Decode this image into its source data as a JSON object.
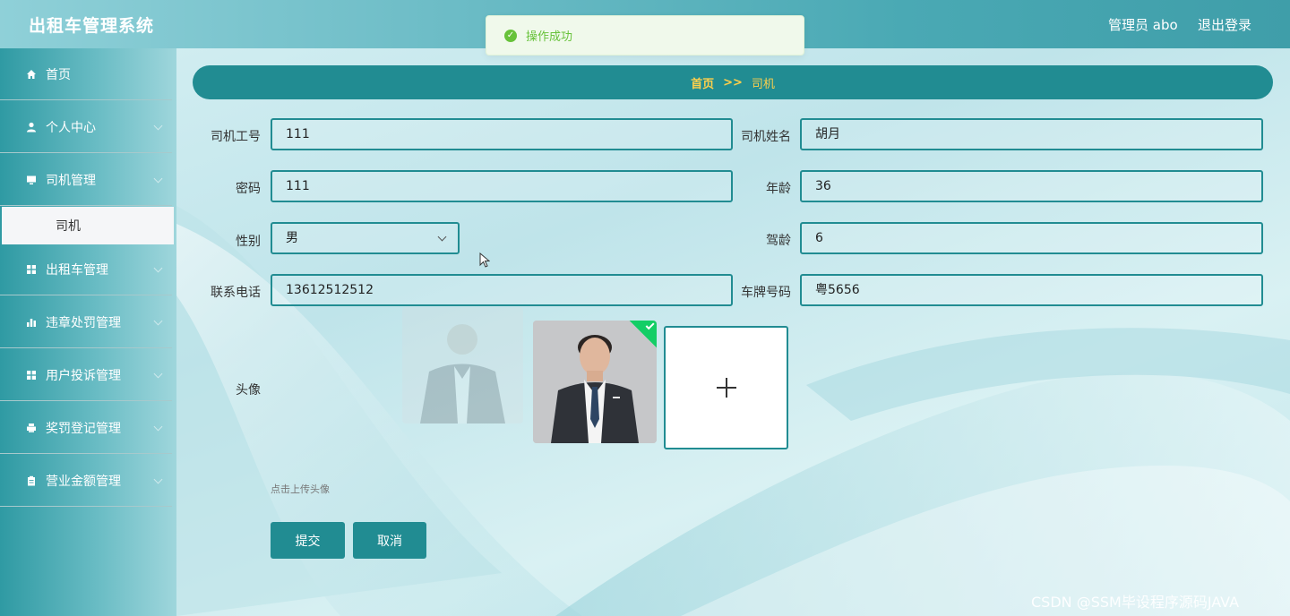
{
  "header": {
    "title": "出租车管理系统",
    "user": "管理员 abo",
    "logout": "退出登录"
  },
  "toast": {
    "message": "操作成功"
  },
  "sidebar": {
    "items": [
      {
        "label": "首页",
        "icon": "home-icon"
      },
      {
        "label": "个人中心",
        "icon": "user-icon"
      },
      {
        "label": "司机管理",
        "icon": "monitor-icon"
      },
      {
        "label": "出租车管理",
        "icon": "grid-icon"
      },
      {
        "label": "违章处罚管理",
        "icon": "bar-chart-icon"
      },
      {
        "label": "用户投诉管理",
        "icon": "grid-icon"
      },
      {
        "label": "奖罚登记管理",
        "icon": "printer-icon"
      },
      {
        "label": "营业金额管理",
        "icon": "clipboard-icon"
      }
    ],
    "active_sub": "司机"
  },
  "breadcrumb": {
    "home": "首页",
    "separator": ">>",
    "current": "司机"
  },
  "form": {
    "driver_id_label": "司机工号",
    "driver_id_value": "111",
    "driver_name_label": "司机姓名",
    "driver_name_value": "胡月",
    "password_label": "密码",
    "password_value": "111",
    "age_label": "年龄",
    "age_value": "36",
    "gender_label": "性别",
    "gender_value": "男",
    "driving_years_label": "驾龄",
    "driving_years_value": "6",
    "phone_label": "联系电话",
    "phone_value": "13612512512",
    "plate_label": "车牌号码",
    "plate_value": "粤5656",
    "avatar_label": "头像",
    "upload_hint": "点击上传头像",
    "submit": "提交",
    "cancel": "取消"
  },
  "watermark": "CSDN @SSM毕设程序源码JAVA",
  "colors": {
    "primary": "#218c92",
    "breadcrumb_text": "#ffd04b",
    "success": "#67c23a"
  }
}
